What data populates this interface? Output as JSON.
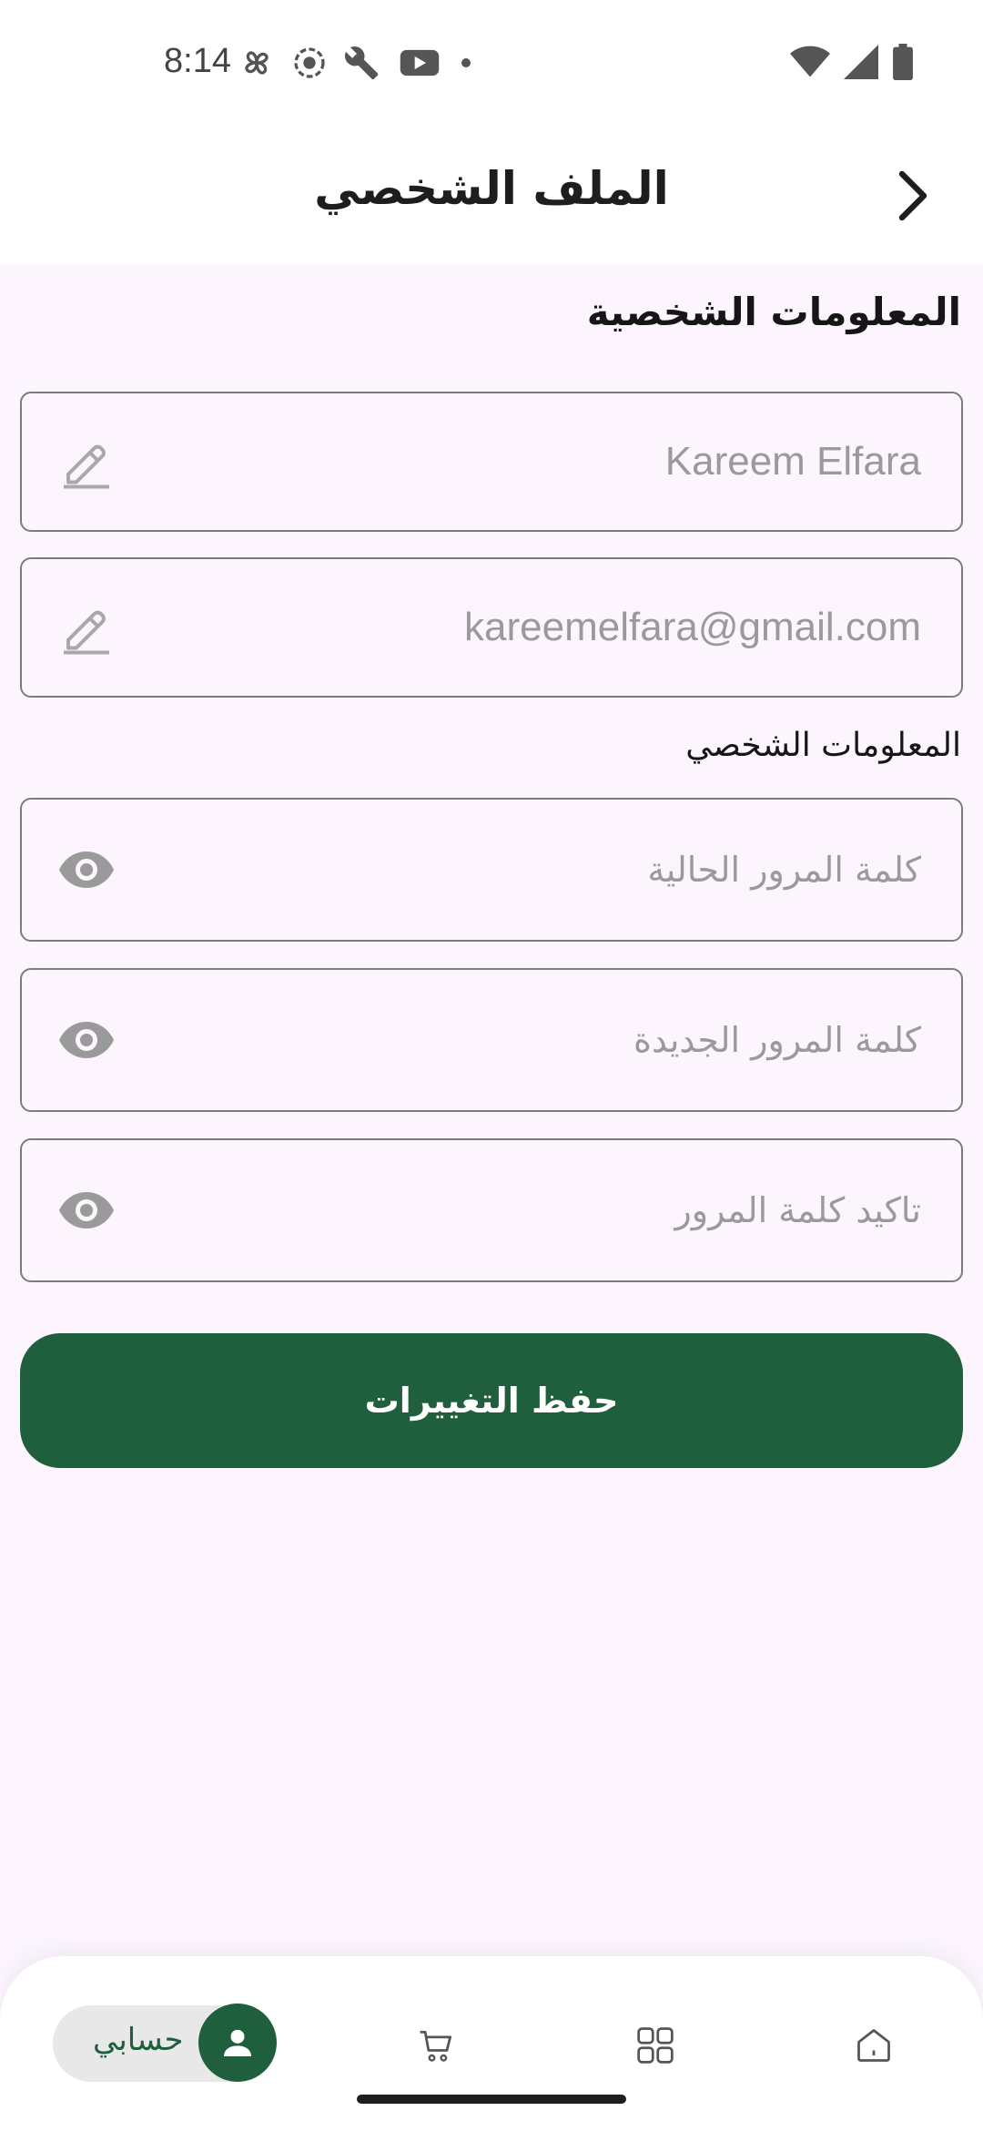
{
  "status_bar": {
    "time": "8:14",
    "left_icons": [
      "fan-icon",
      "record-icon",
      "wrench-icon",
      "youtube-icon",
      "dot-icon"
    ],
    "right_icons": [
      "wifi-icon",
      "signal-icon",
      "battery-icon"
    ]
  },
  "app_bar": {
    "title": "الملف الشخصي",
    "back_icon": "chevron-right-icon"
  },
  "personal_info": {
    "heading": "المعلومات الشخصية",
    "name_value": "Kareem Elfara",
    "email_value": "kareemelfara@gmail.com",
    "edit_icon": "pencil-icon"
  },
  "password_section": {
    "heading": "المعلومات الشخصي",
    "current_password_placeholder": "كلمة المرور الحالية",
    "new_password_placeholder": "كلمة المرور الجديدة",
    "confirm_password_placeholder": "تاكيد كلمة المرور",
    "visibility_icon": "eye-icon"
  },
  "save_button": {
    "label": "حفظ التغييرات"
  },
  "bottom_nav": {
    "account_label": "حسابي",
    "items": [
      "account",
      "cart",
      "categories",
      "home"
    ]
  },
  "colors": {
    "primary": "#1f5f3d",
    "background": "#fcf5fd",
    "border": "#7b7b80",
    "hint_text": "#9a9a9a"
  }
}
